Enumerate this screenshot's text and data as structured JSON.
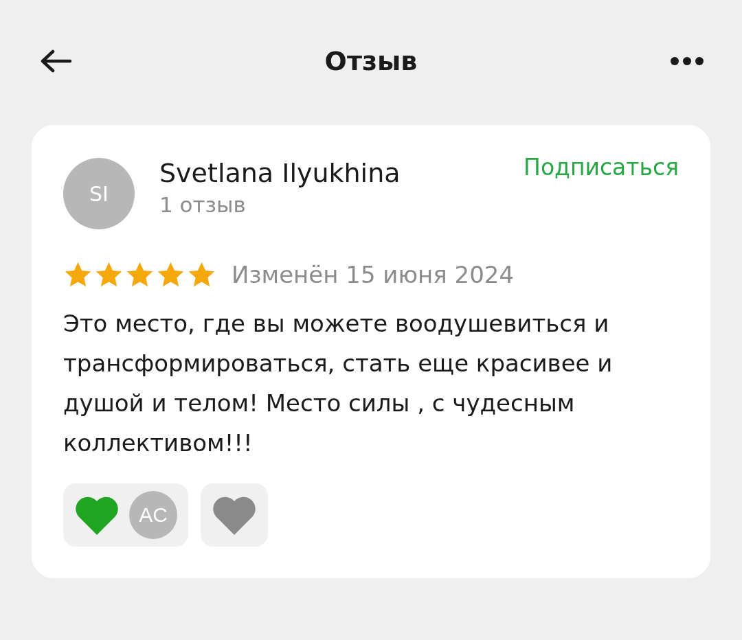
{
  "header": {
    "title": "Отзыв"
  },
  "review": {
    "author": {
      "initials": "SI",
      "name": "Svetlana Ilyukhina",
      "count": "1 отзыв"
    },
    "subscribe": "Подписаться",
    "stars": 5,
    "date": "Изменён 15 июня 2024",
    "text": "Это место, где вы можете воодушевиться и трансформироваться, стать еще красивее и душой и телом! Место силы , с чудесным коллективом!!!",
    "reactions": [
      {
        "color": "#1fa51f",
        "avatars": [
          "AC"
        ]
      },
      {
        "color": "#8a8a8a"
      }
    ]
  }
}
